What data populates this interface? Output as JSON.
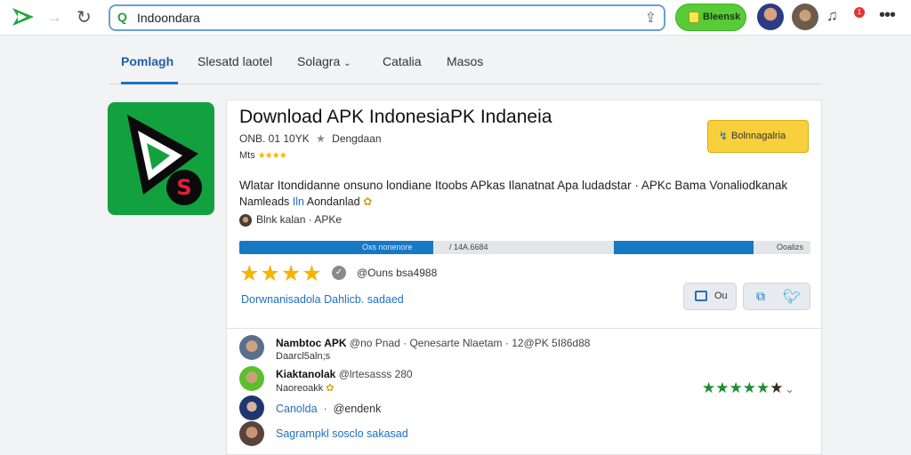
{
  "browser": {
    "url_text": "Indoondara",
    "action_button_label": "Bleensk",
    "notification_count": "1"
  },
  "tabs": [
    {
      "label": "Pomlagh",
      "active": true
    },
    {
      "label": "Slesatd laotel",
      "active": false
    },
    {
      "label": "Solagra",
      "active": false,
      "dropdown": true
    },
    {
      "label": "Catalia",
      "active": false
    },
    {
      "label": "Masos",
      "active": false
    }
  ],
  "app": {
    "title": "Download APK IndonesiaPK Indaneia",
    "meta_line": "ONB. 01 10YK",
    "meta_developer": "Dengdaan",
    "meta_rating_label": "Mts",
    "download_label": "Bolnnagalria",
    "description_line1": "Wlatar Itondidanne onsuno londiane Itoobs APkas Ilanatnat Apa ludadstar · APKc Bama Vonaliodkanak",
    "description_line2_prefix": "Namleads",
    "description_line2_link": "Iln",
    "description_line2_suffix": "Aondanlad",
    "developer_line": "Blnk kalan · APKe",
    "progress": {
      "segment1_fraction": 0.34,
      "segment2_start_fraction": 0.655,
      "segment2_fraction": 0.245,
      "segment1_label": "Oxs nonenore",
      "mid_label": "/ 14A.6684",
      "end_label": "Ooalizs"
    },
    "rating_value": 4,
    "rating_max": 5,
    "rating_text": "@Ouns bsa4988",
    "links_text": "Dorwnanisadola Dahlicb.  sadaed",
    "share_button_a_label": "Ou"
  },
  "comments": [
    {
      "name": "Nambtoc APK",
      "meta": "@no Pnad · Qenesarte Nlaetam · 12@PK 5I86d88",
      "sub": "Daarcl5aln;s"
    },
    {
      "name": "Kiaktanolak",
      "meta": "@lrtesasss 280",
      "sub": "Naoreoakk"
    },
    {
      "link": "Canolda",
      "handle": "@endenk"
    },
    {
      "link": "Sagrampkl sosclo sakasad"
    }
  ],
  "review_rating": {
    "value": 5,
    "max": 6
  },
  "colors": {
    "accent_blue": "#1f6fc4",
    "brand_green": "#13a13f",
    "star_yellow": "#f4b400",
    "download_yellow": "#f8cf3c",
    "action_green": "#58cb38"
  }
}
